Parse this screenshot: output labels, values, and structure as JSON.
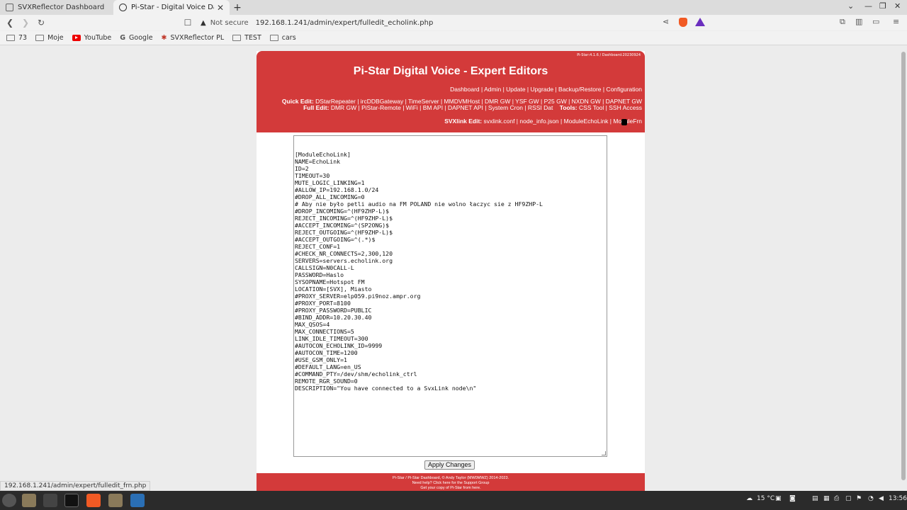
{
  "browser": {
    "tabs": [
      {
        "label": "SVXReflector Dashboard",
        "active": false
      },
      {
        "label": "Pi-Star - Digital Voice Dashbo",
        "active": true
      }
    ],
    "security_label": "Not secure",
    "url": "192.168.1.241/admin/expert/fulledit_echolink.php",
    "bookmarks": [
      "73",
      "Moje",
      "YouTube",
      "Google",
      "SVXReflector PL",
      "TEST",
      "cars"
    ],
    "status_url": "192.168.1.241/admin/expert/fulledit_frn.php"
  },
  "page": {
    "version": "Pi-Star:4.1.6 / Dashboard:20230924",
    "title": "Pi-Star Digital Voice - Expert Editors",
    "nav_line": "Dashboard | Admin | Update | Upgrade | Backup/Restore | Configuration",
    "quick_edit_label": "Quick Edit:",
    "quick_edit_links": "DStarRepeater | ircDDBGateway | TimeServer | MMDVMHost | DMR GW | YSF GW | P25 GW | NXDN GW | DAPNET GW",
    "full_edit_label": "Full Edit:",
    "full_edit_links": "DMR GW | PiStar-Remote | WiFi | BM API | DAPNET API | System Cron | RSSI Dat",
    "tools_label": "Tools:",
    "tools_links": "CSS Tool | SSH Access",
    "svxlink_label": "SVXlink Edit:",
    "svxlink_links": "svxlink.conf | node_info.json | ModuleEchoLink | ModuleFrn",
    "apply_button": "Apply Changes",
    "footer": [
      "Pi-Star / Pi-Star Dashboard, © Andy Taylor (MW0MWZ) 2014-2023.",
      "Need help? Click here for the Support Group",
      "Get your copy of Pi-Star from here."
    ]
  },
  "editor_lines": [
    "[ModuleEchoLink]",
    "NAME=EchoLink",
    "ID=2",
    "TIMEOUT=30",
    "MUTE_LOGIC_LINKING=1",
    "#ALLOW_IP=192.168.1.0/24",
    "#DROP_ALL_INCOMING=0",
    "# Aby nie było petli audio na FM POLAND nie wolno łaczyc sie z HF9ZHP-L",
    "#DROP_INCOMING=^(HF9ZHP-L)$",
    "REJECT_INCOMING=^(HF9ZHP-L)$",
    "#ACCEPT_INCOMING=^(SP2ONG)$",
    "REJECT_OUTGOING=^(HF9ZHP-L)$",
    "#ACCEPT_OUTGOING=^(.*)$",
    "REJECT_CONF=1",
    "#CHECK_NR_CONNECTS=2,300,120",
    "SERVERS=servers.echolink.org",
    "CALLSIGN=N0CALL-L",
    "PASSWORD=Haslo",
    "SYSOPNAME=Hotspot FM",
    "LOCATION=[SVX], Miasto",
    "#PROXY_SERVER=elp059.pi9noz.ampr.org",
    "#PROXY_PORT=8100",
    "#PROXY_PASSWORD=PUBLIC",
    "#BIND_ADDR=10.20.30.40",
    "MAX_QSOS=4",
    "MAX_CONNECTIONS=5",
    "LINK_IDLE_TIMEOUT=300",
    "#AUTOCON_ECHOLINK_ID=9999",
    "#AUTOCON_TIME=1200",
    "#USE_GSM_ONLY=1",
    "#DEFAULT_LANG=en_US",
    "#COMMAND_PTY=/dev/shm/echolink_ctrl",
    "REMOTE_RGR_SOUND=0",
    "DESCRIPTION=\"You have connected to a SvxLink node\\n\""
  ],
  "taskbar": {
    "weather": "15 °C",
    "time": "13:56"
  },
  "colors": {
    "pistar_red": "#d33a3a",
    "page_bg": "#ececec"
  }
}
